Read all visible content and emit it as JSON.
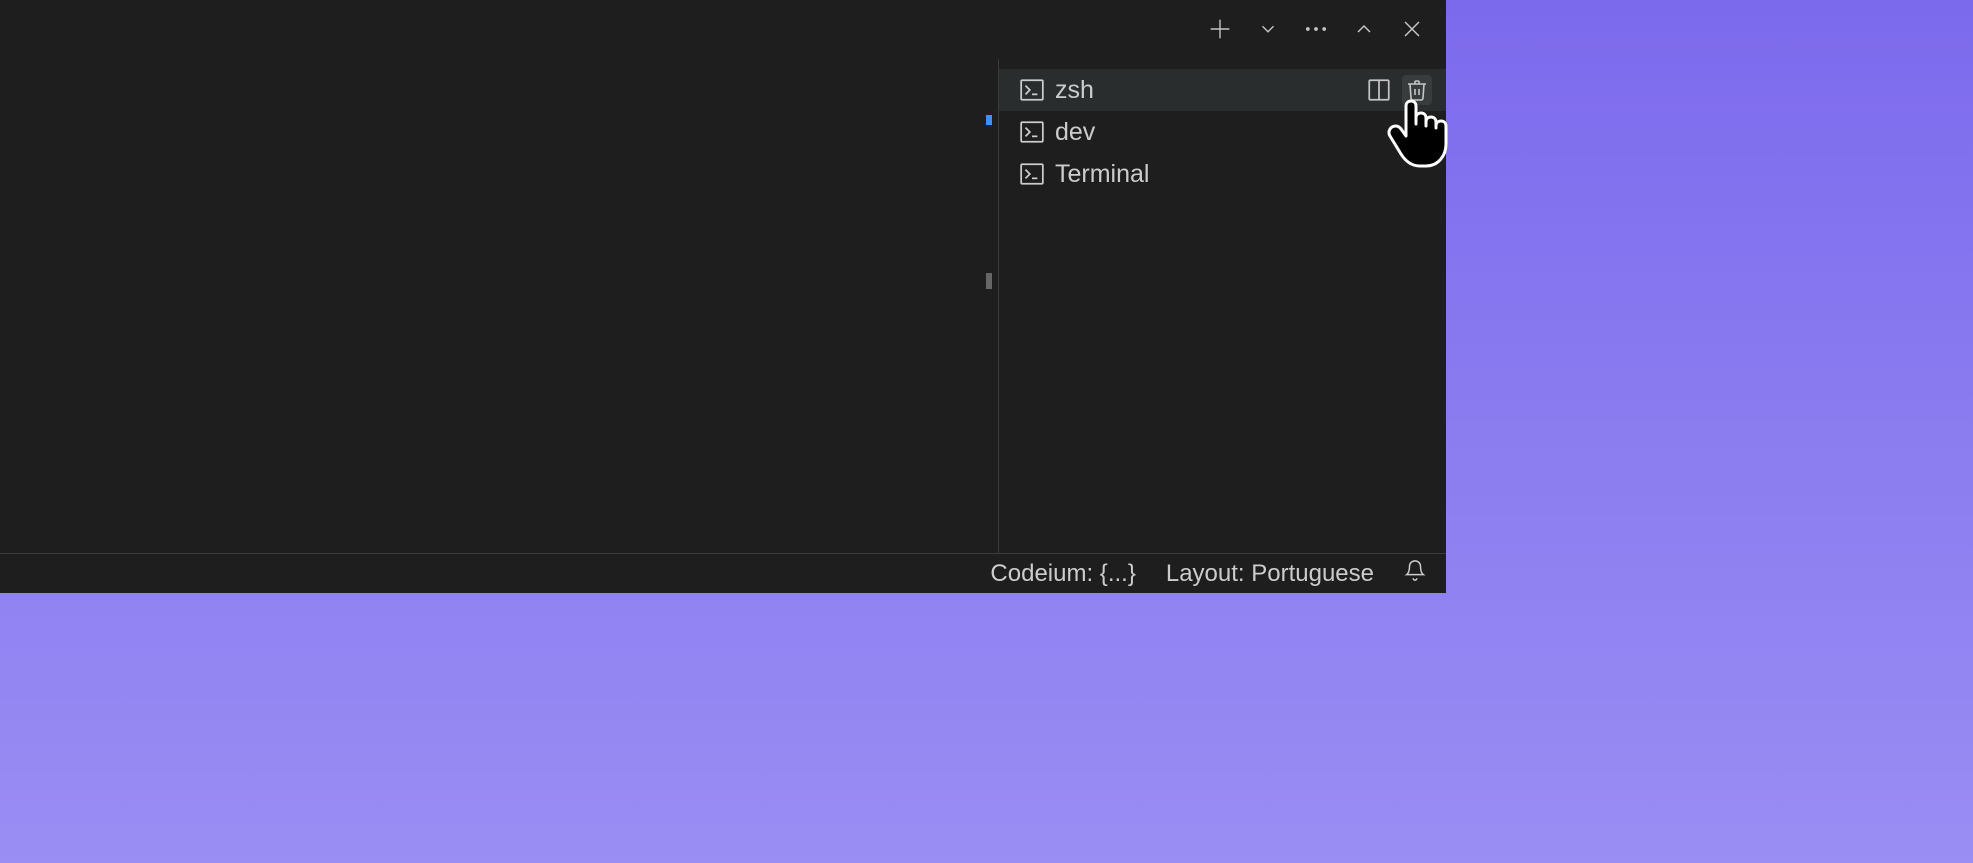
{
  "terminals": [
    {
      "label": "zsh",
      "active": true
    },
    {
      "label": "dev",
      "active": false
    },
    {
      "label": "Terminal",
      "active": false
    }
  ],
  "status": {
    "codeium": "Codeium: {...}",
    "layout": "Layout: Portuguese"
  }
}
